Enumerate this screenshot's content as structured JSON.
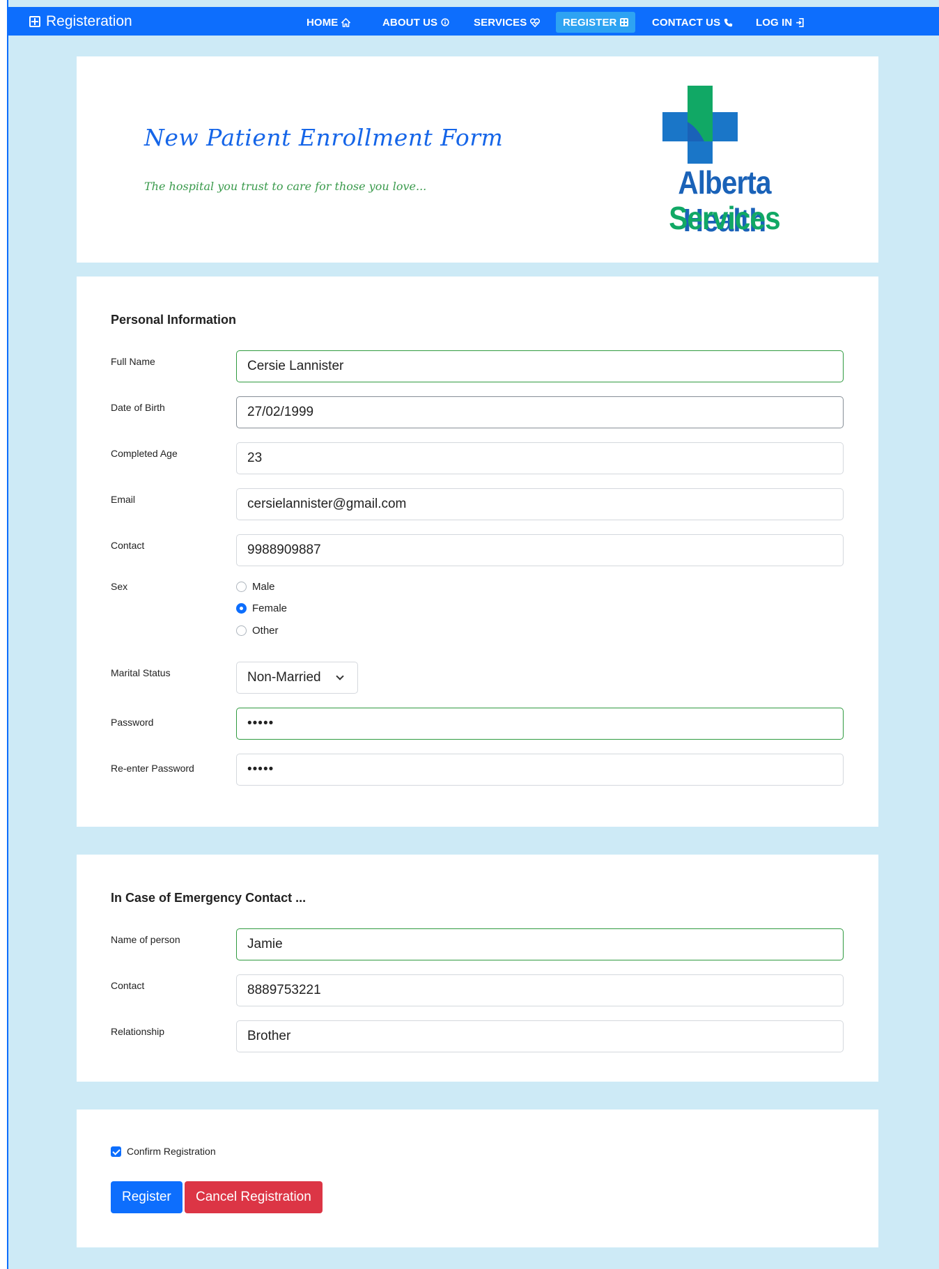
{
  "navbar": {
    "brand": "Registeration",
    "items": [
      {
        "label": "HOME",
        "icon": "home-icon"
      },
      {
        "label": "ABOUT US",
        "icon": "info-icon"
      },
      {
        "label": "SERVICES",
        "icon": "heart-pulse-icon"
      },
      {
        "label": "REGISTER",
        "icon": "plus-square-icon"
      },
      {
        "label": "CONTACT US",
        "icon": "phone-icon"
      },
      {
        "label": "LOG IN",
        "icon": "login-icon"
      }
    ],
    "active": "REGISTER",
    "color": "#0d6efd"
  },
  "hero": {
    "title": "New Patient Enrollment Form",
    "subtitle": "The hospital you trust to care for those you love...",
    "logo_line1": "Alberta Health",
    "logo_line2": "Services"
  },
  "personal": {
    "section_title": "Personal Information",
    "full_name_label": "Full Name",
    "full_name_value": "Cersie Lannister",
    "dob_label": "Date of Birth",
    "dob_value": "27/02/1999",
    "age_label": "Completed Age",
    "age_value": "23",
    "email_label": "Email",
    "email_value": "cersielannister@gmail.com",
    "contact_label": "Contact",
    "contact_value": "9988909887",
    "sex_label": "Sex",
    "sex_options": [
      "Male",
      "Female",
      "Other"
    ],
    "sex_selected": "Female",
    "marital_label": "Marital Status",
    "marital_value": "Non-Married",
    "password_label": "Password",
    "password_value": "•••••",
    "repassword_label": "Re-enter Password",
    "repassword_value": "•••••"
  },
  "emergency": {
    "section_title": "In Case of Emergency Contact ...",
    "name_label": "Name of person",
    "name_value": "Jamie",
    "contact_label": "Contact",
    "contact_value": "8889753221",
    "relationship_label": "Relationship",
    "relationship_value": "Brother"
  },
  "confirm": {
    "checkbox_label": "Confirm Registration",
    "checked": true,
    "register_label": "Register",
    "cancel_label": "Cancel Registration"
  },
  "colors": {
    "background": "#cdeaf6",
    "primary": "#0d6efd",
    "danger": "#dc3545",
    "valid": "#2f9a3f",
    "title": "#1565e8",
    "subtitle": "#3a9a4c",
    "logo_blue": "#1a62b8",
    "logo_green": "#11a865"
  }
}
